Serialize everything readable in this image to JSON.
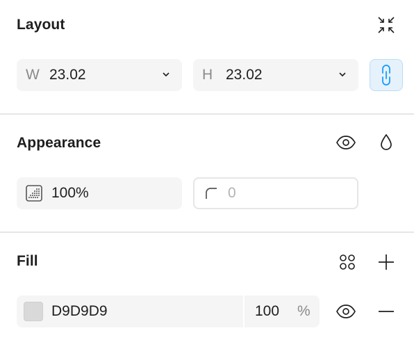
{
  "layout": {
    "title": "Layout",
    "width_label": "W",
    "width_value": "23.02",
    "height_label": "H",
    "height_value": "23.02",
    "icons": [
      "collapse-icon",
      "chevron-down-icon",
      "link-icon"
    ]
  },
  "appearance": {
    "title": "Appearance",
    "opacity_value": "100%",
    "radius_placeholder": "0",
    "icons": [
      "eye-icon",
      "drop-icon",
      "opacity-icon",
      "corner-radius-icon"
    ]
  },
  "fill": {
    "title": "Fill",
    "hex_value": "D9D9D9",
    "opacity_value": "100",
    "opacity_unit": "%",
    "swatch_color": "#D9D9D9",
    "icons": [
      "styles-grid-icon",
      "plus-icon",
      "eye-icon",
      "minus-icon"
    ]
  },
  "colors": {
    "accent_bg": "#E5F1FB",
    "accent": "#0D99FF"
  }
}
